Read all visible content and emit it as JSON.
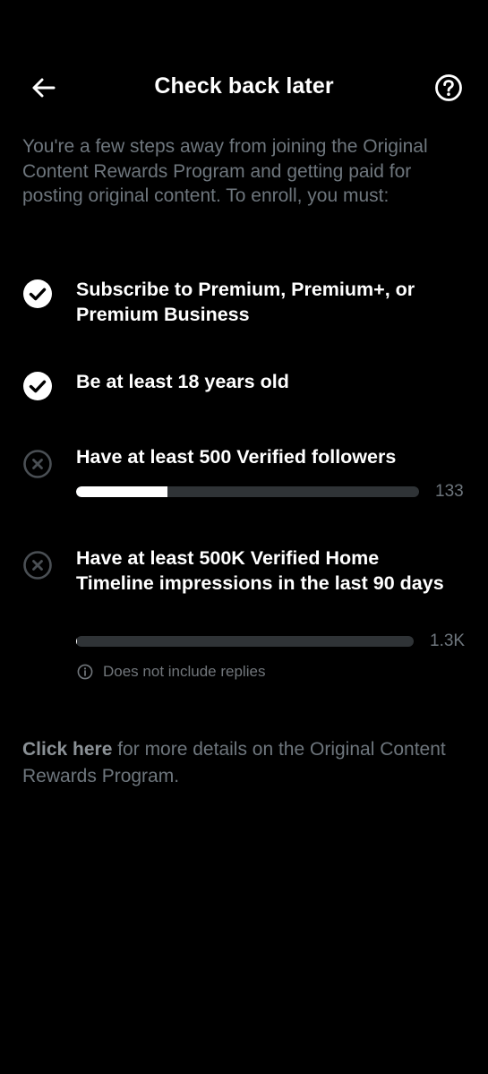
{
  "header": {
    "title": "Check back later",
    "back_icon": "arrow-left-icon",
    "help_icon": "question-circle-icon"
  },
  "intro": {
    "text": "You're a few steps away from joining the Original Content Rewards Program and getting paid for posting original content. To enroll, you must:"
  },
  "requirements": [
    {
      "label": "Subscribe to Premium, Premium+, or Premium Business",
      "status": "complete",
      "icon": "check-circle-icon"
    },
    {
      "label": "Be at least 18 years old",
      "status": "complete",
      "icon": "check-circle-icon"
    },
    {
      "label": "Have at least 500 Verified followers",
      "status": "incomplete",
      "icon": "x-circle-icon",
      "progress_count": "133",
      "progress_fraction": 0.266
    },
    {
      "label": "Have at least 500K Verified Home Timeline impressions in the last 90 days",
      "status": "incomplete",
      "icon": "x-circle-icon",
      "progress_count": "1.3K",
      "progress_fraction": 0.0026,
      "note": "Does not include replies",
      "note_icon": "info-icon"
    }
  ],
  "footer": {
    "link_text": "Click here",
    "rest_text": " for more details on the Original Content Rewards Program."
  },
  "colors": {
    "background": "#000000",
    "text_primary": "#ffffff",
    "text_secondary": "#6e767d",
    "track": "#2f3336",
    "fill": "#ffffff"
  }
}
